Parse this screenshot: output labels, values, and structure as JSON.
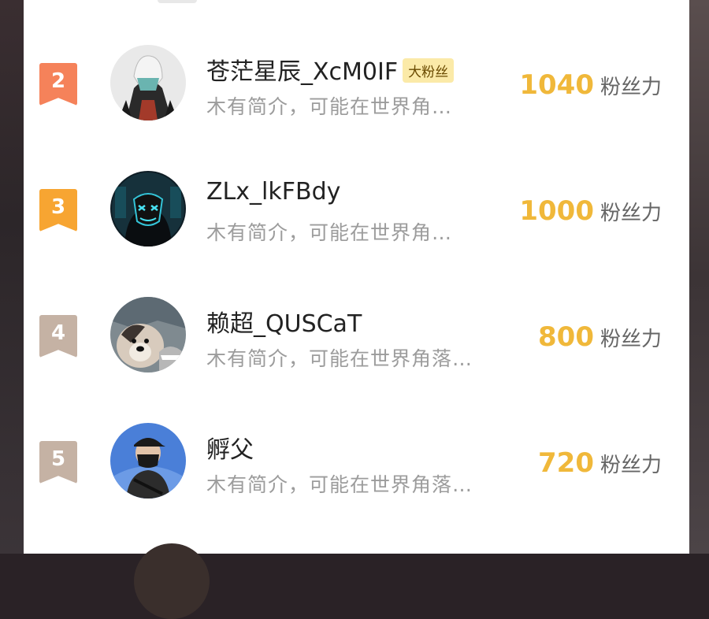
{
  "fans": [
    {
      "rank": "2",
      "name": "苍茫星辰_XcM0IF",
      "tag": "大粉丝",
      "bio": "木有简介，可能在世界角…",
      "score": "1040",
      "score_label": "粉丝力",
      "badge_color": "#f5825a",
      "avatar_icon": "masked-hooded-figure-icon"
    },
    {
      "rank": "3",
      "name": "ZLx_lkFBdy",
      "tag": "",
      "bio": "木有简介，可能在世界角…",
      "score": "1000",
      "score_label": "粉丝力",
      "badge_color": "#f7a532",
      "avatar_icon": "neon-mask-icon"
    },
    {
      "rank": "4",
      "name": "赖超_QUSCaT",
      "tag": "",
      "bio": "木有简介，可能在世界角落…",
      "score": "800",
      "score_label": "粉丝力",
      "badge_color": "#c5b2a4",
      "avatar_icon": "husky-dog-icon"
    },
    {
      "rank": "5",
      "name": "孵父",
      "tag": "",
      "bio": "木有简介，可能在世界角落…",
      "score": "720",
      "score_label": "粉丝力",
      "badge_color": "#c5b2a4",
      "avatar_icon": "masked-man-cap-icon"
    }
  ]
}
